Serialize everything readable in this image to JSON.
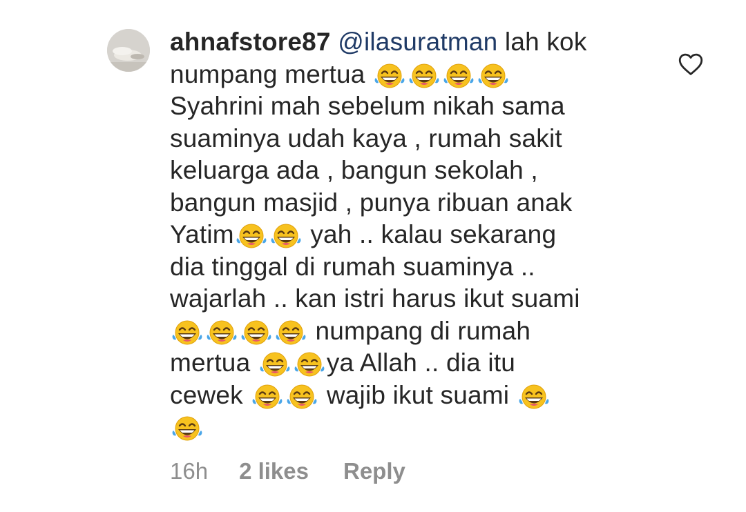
{
  "comment": {
    "username": "ahnafstore87",
    "mention": "@ilasuratman",
    "lines": [
      [
        {
          "t": " lah kok"
        }
      ],
      [
        {
          "t": "numpang mertua "
        },
        {
          "e": 4
        }
      ],
      [
        {
          "t": "Syahrini mah sebelum nikah sama"
        }
      ],
      [
        {
          "t": "suaminya udah kaya , rumah sakit"
        }
      ],
      [
        {
          "t": "keluarga ada , bangun sekolah ,"
        }
      ],
      [
        {
          "t": "bangun masjid , punya ribuan anak"
        }
      ],
      [
        {
          "t": "Yatim"
        },
        {
          "e": 2
        },
        {
          "t": " yah .. kalau sekarang"
        }
      ],
      [
        {
          "t": "dia tinggal di rumah suaminya .."
        }
      ],
      [
        {
          "t": "wajarlah .. kan istri harus ikut suami"
        }
      ],
      [
        {
          "e": 4
        },
        {
          "t": " numpang di rumah"
        }
      ],
      [
        {
          "t": "mertua "
        },
        {
          "e": 2
        },
        {
          "t": "ya Allah .. dia itu"
        }
      ],
      [
        {
          "t": "cewek "
        },
        {
          "e": 2
        },
        {
          "t": " wajib ikut suami "
        },
        {
          "e": 1
        }
      ],
      [
        {
          "e": 1
        }
      ]
    ],
    "emoji_name": "face-with-tears-of-joy-icon"
  },
  "meta": {
    "time": "16h",
    "likes": "2 likes",
    "reply": "Reply"
  },
  "icons": {
    "like": "heart-outline-icon",
    "avatar": "avatar"
  },
  "colors": {
    "text": "#262626",
    "secondary": "#8e8e8e",
    "mention": "#1f3a66",
    "emoji_face": "#f7c21f"
  }
}
